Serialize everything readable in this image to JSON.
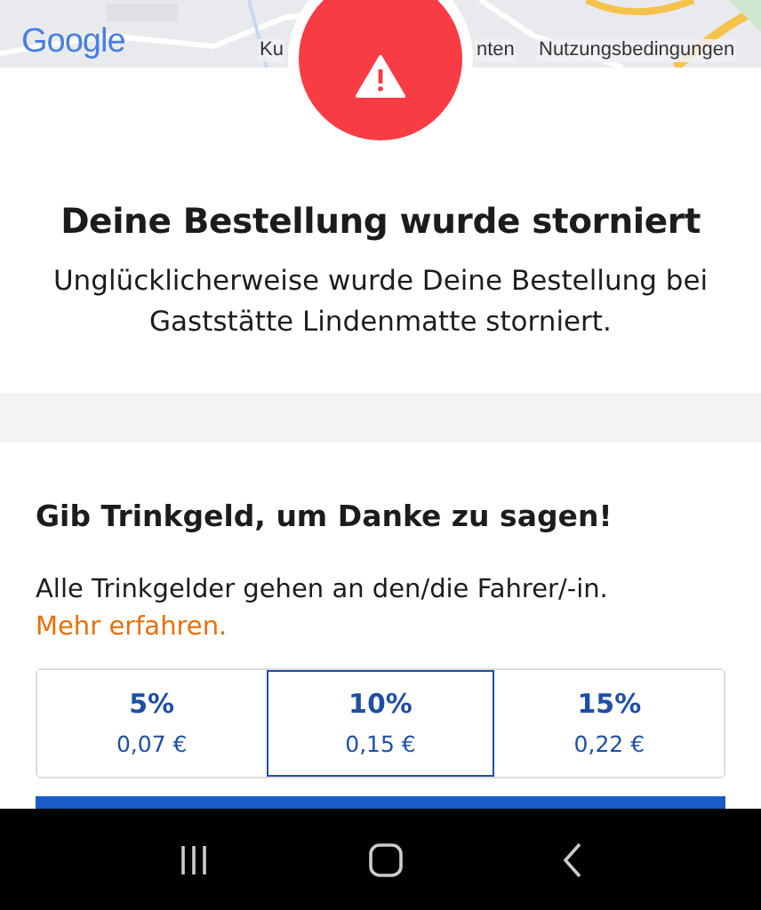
{
  "map": {
    "logo": "Google",
    "attribution": [
      "Ku",
      "nten",
      "Nutzungsbedingungen"
    ]
  },
  "status": {
    "title": "Deine Bestellung wurde storniert",
    "message": "Unglücklicherweise wurde Deine Bestellung bei Gaststätte Lindenmatte storniert."
  },
  "tip": {
    "heading": "Gib Trinkgeld, um Danke zu sagen!",
    "text": "Alle Trinkgelder gehen an den/die Fahrer/-in.",
    "link": "Mehr erfahren.",
    "options": [
      {
        "percent": "5%",
        "amount": "0,07 €",
        "selected": false
      },
      {
        "percent": "10%",
        "amount": "0,15 €",
        "selected": true
      },
      {
        "percent": "15%",
        "amount": "0,22 €",
        "selected": false
      }
    ]
  }
}
